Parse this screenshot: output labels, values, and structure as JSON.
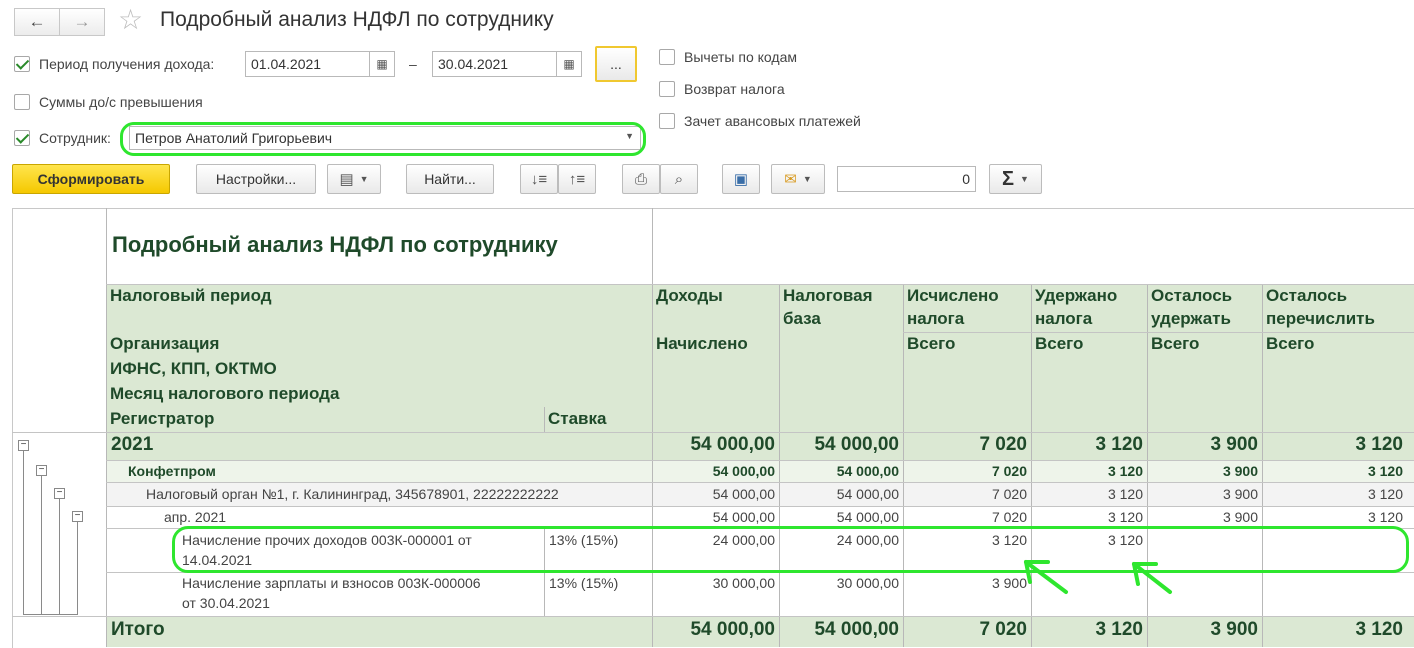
{
  "window": {
    "title": "Подробный анализ НДФЛ по сотруднику"
  },
  "form": {
    "period_label": "Период получения дохода:",
    "period_from": "01.04.2021",
    "period_dash": "–",
    "period_to": "30.04.2021",
    "period_btn": "...",
    "sums_label": "Суммы до/с превышения",
    "employee_label": "Сотрудник:",
    "employee_value": "Петров Анатолий Григорьевич",
    "options": [
      {
        "label": "Вычеты по кодам",
        "checked": false
      },
      {
        "label": "Возврат налога",
        "checked": false
      },
      {
        "label": "Зачет авансовых платежей",
        "checked": false
      }
    ]
  },
  "toolbar": {
    "generate": "Сформировать",
    "settings": "Настройки...",
    "find": "Найти...",
    "sum_value": "0",
    "sigma": "Σ"
  },
  "report": {
    "title": "Подробный анализ НДФЛ по сотруднику",
    "headers": {
      "tax_period": "Налоговый период",
      "organization": "Организация",
      "ifns": "ИФНС, КПП, ОКТМО",
      "month": "Месяц налогового периода",
      "registrar": "Регистратор",
      "rate": "Ставка",
      "income": "Доходы",
      "accrued": "Начислено",
      "tax_base": "Налоговая база",
      "calculated": "Исчислено налога",
      "withheld": "Удержано налога",
      "left_withhold": "Осталось удержать",
      "left_transfer": "Осталось перечислить",
      "total_sub": "Всего"
    },
    "rows": [
      {
        "label": "2021",
        "rate": "",
        "values": [
          "54 000,00",
          "54 000,00",
          "7 020",
          "3 120",
          "3 900",
          "3 120"
        ]
      },
      {
        "label": "Конфетпром",
        "rate": "",
        "values": [
          "54 000,00",
          "54 000,00",
          "7 020",
          "3 120",
          "3 900",
          "3 120"
        ]
      },
      {
        "label": "Налоговый орган №1, г. Калининград, 345678901, 22222222222",
        "rate": "",
        "values": [
          "54 000,00",
          "54 000,00",
          "7 020",
          "3 120",
          "3 900",
          "3 120"
        ]
      },
      {
        "label": "апр. 2021",
        "rate": "",
        "values": [
          "54 000,00",
          "54 000,00",
          "7 020",
          "3 120",
          "3 900",
          "3 120"
        ]
      },
      {
        "label1": "Начисление прочих доходов 003К-000001 от",
        "label2": "14.04.2021",
        "rate": "13% (15%)",
        "values": [
          "24 000,00",
          "24 000,00",
          "3 120",
          "3 120",
          "",
          ""
        ]
      },
      {
        "label1": "Начисление зарплаты и взносов 003К-000006",
        "label2": "от 30.04.2021",
        "rate": "13% (15%)",
        "values": [
          "30 000,00",
          "30 000,00",
          "3 900",
          "",
          "",
          ""
        ]
      }
    ],
    "total": {
      "label": "Итого",
      "values": [
        "54 000,00",
        "54 000,00",
        "7 020",
        "3 120",
        "3 900",
        "3 120"
      ]
    }
  },
  "colors": {
    "header_bg": "#dbe8d3",
    "highlight": "#2ee62e",
    "primary_btn": "#f5c800"
  }
}
